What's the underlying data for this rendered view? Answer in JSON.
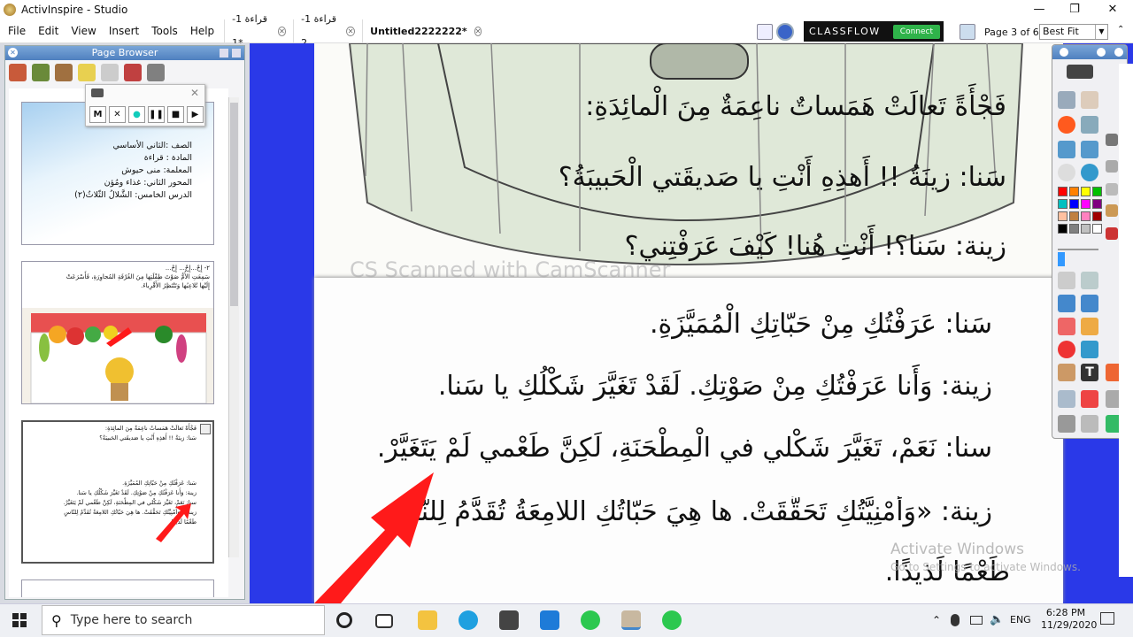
{
  "window": {
    "title": "ActivInspire - Studio"
  },
  "menu": [
    "File",
    "Edit",
    "View",
    "Insert",
    "Tools",
    "Help"
  ],
  "tabs": [
    {
      "label": "قراءة 1-1*"
    },
    {
      "label": "قراءة 1-2"
    },
    {
      "label": "Untitled2222222*"
    }
  ],
  "classflow": {
    "brand": "CLASSFLOW",
    "connect": "Connect"
  },
  "page_indicator": "Page 3 of 6",
  "zoom": "Best Fit",
  "page_browser": {
    "title": "Page Browser",
    "thumb1_lines": [
      "الصف :الثاني الأساسي",
      "المادة : قراءة",
      "المعلمة: منى حيوش",
      "المحور الثاني: غذاء ومُؤن",
      "الدرس الخامس: الشَّلالُ الثّلاثُ(٢)"
    ],
    "thumb2_lines": [
      "٢- إِحْ...إِحْ... إِحْ...",
      "سَمِعَتِ الأُمُّ صَوْتَ طِفْلَتِها مِنَ الغُرْفَةِ المُجاوِرَةِ، فَأَسْرَعَتْ",
      "إِلَيْها تُلاعِبُها وَتَنْتَظِرُ الأَقْرِباءَ."
    ],
    "thumb3_lines": [
      "فَجْأَةً تَعالَتْ هَمَساتٌ ناعِمَةٌ مِنَ المائِدَةِ:",
      "سَنا: زينَةُ !! أَهذِهِ أَنْتِ يا صَديقَتي الحَبيبَةُ؟",
      "سَنا: عَرَفْتُكِ مِنْ حَبّاتِكِ المُمَيَّزَةِ.",
      "زينة: وَأَنا عَرَفْتُكِ مِنْ صَوْتِكِ. لَقَدْ تَغَيَّرَ شَكْلُكِ يا سَنا.",
      "سنا: نَعَمْ، تَغَيَّرَ شَكْلي في المِطْحَنَةِ، لَكِنَّ طَعْمي لَمْ يَتَغَيَّرْ.",
      "زينة: «وَأُمْنِيَّتُكِ تَحَقَّقَتْ. ها هِيَ حَبّاتُكِ اللامِعَةُ تُقَدَّمُ لِلنّاسِ",
      "طَعْمًا لَذيذًا."
    ]
  },
  "recorder": {
    "buttons": [
      "M",
      "✕",
      "●",
      "❚❚",
      "■",
      "▶"
    ]
  },
  "flipchart": {
    "upper_lines": [
      "فَجْأَةً تَعالَتْ هَمَساتٌ ناعِمَةٌ مِنَ الْمائِدَةِ:",
      "سَنا: زينَةُ !! أَهذِهِ أَنْتِ يا صَديقَتي الْحَبيبَةُ؟",
      "زينة: سَنا؟! أَنْتِ هُنا! كَيْفَ عَرَفْتِني؟"
    ],
    "scan_watermark": "CS  Scanned with CamScanner",
    "lower_lines": [
      "سَنا: عَرَفْتُكِ مِنْ حَبّاتِكِ الْمُمَيَّزَةِ.",
      "زينة: وَأَنا عَرَفْتُكِ مِنْ صَوْتِكِ. لَقَدْ تَغَيَّرَ شَكْلُكِ يا سَنا.",
      "سنا: نَعَمْ، تَغَيَّرَ شَكْلي في الْمِطْحَنَةِ، لَكِنَّ طَعْمي لَمْ يَتَغَيَّرْ.",
      "زينة: «وَأُمْنِيَّتُكِ تَحَقَّقَتْ. ها هِيَ حَبّاتُكِ اللامِعَةُ تُقَدَّمُ لِلنّاسِ",
      "طَعْمًا لَذيذًا."
    ],
    "arrow_color": "#ff1a1a"
  },
  "toolbox": {
    "swatches": [
      "#ff0000",
      "#ff8000",
      "#ffff00",
      "#00c000",
      "#00c0c0",
      "#0000ff",
      "#ff00ff",
      "#800080",
      "#ffc0a0",
      "#c08040",
      "#ff80c0",
      "#a00000",
      "#000000",
      "#808080",
      "#c0c0c0",
      "#ffffff"
    ]
  },
  "activation": {
    "line1": "Activate Windows",
    "line2": "Go to Settings to activate Windows."
  },
  "taskbar": {
    "search_placeholder": "Type here to search",
    "lang": "ENG",
    "time": "6:28 PM",
    "date": "11/29/2020"
  }
}
